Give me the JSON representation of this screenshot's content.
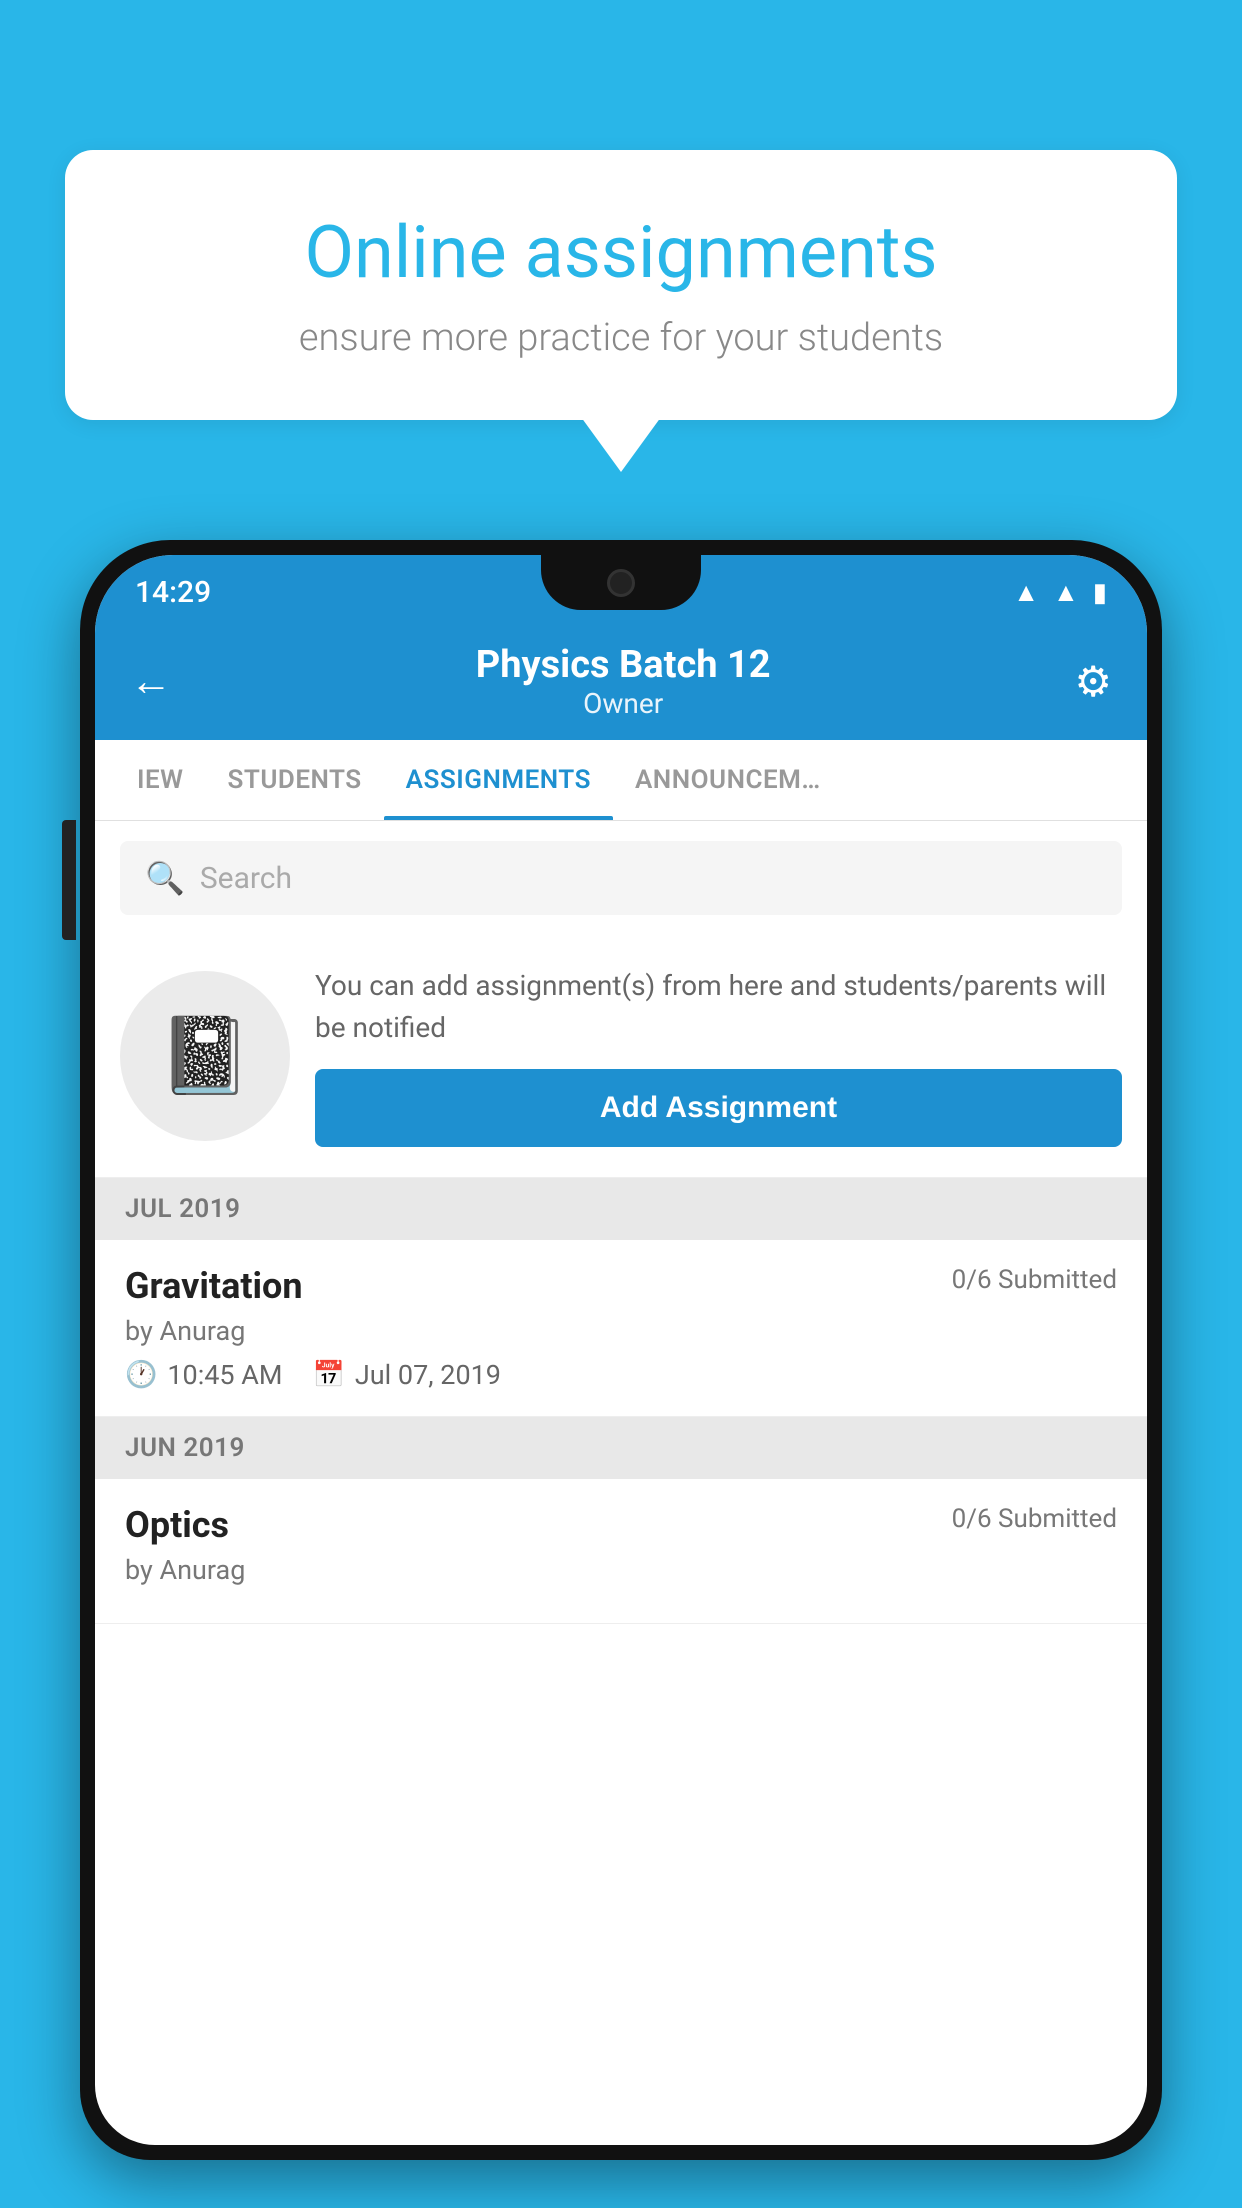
{
  "background_color": "#29B6E8",
  "speech_bubble": {
    "title": "Online assignments",
    "subtitle": "ensure more practice for your students"
  },
  "status_bar": {
    "time": "14:29",
    "icons": [
      "wifi",
      "signal",
      "battery"
    ]
  },
  "header": {
    "title": "Physics Batch 12",
    "subtitle": "Owner",
    "back_label": "←",
    "settings_label": "⚙"
  },
  "tabs": [
    {
      "label": "IEW",
      "active": false
    },
    {
      "label": "STUDENTS",
      "active": false
    },
    {
      "label": "ASSIGNMENTS",
      "active": true
    },
    {
      "label": "ANNOUNCEM…",
      "active": false
    }
  ],
  "search": {
    "placeholder": "Search"
  },
  "promo": {
    "text": "You can add assignment(s) from here and students/parents will be notified",
    "button_label": "Add Assignment"
  },
  "sections": [
    {
      "month": "JUL 2019",
      "assignments": [
        {
          "name": "Gravitation",
          "submitted": "0/6 Submitted",
          "by": "by Anurag",
          "time": "10:45 AM",
          "date": "Jul 07, 2019"
        }
      ]
    },
    {
      "month": "JUN 2019",
      "assignments": [
        {
          "name": "Optics",
          "submitted": "0/6 Submitted",
          "by": "by Anurag",
          "time": "",
          "date": ""
        }
      ]
    }
  ]
}
